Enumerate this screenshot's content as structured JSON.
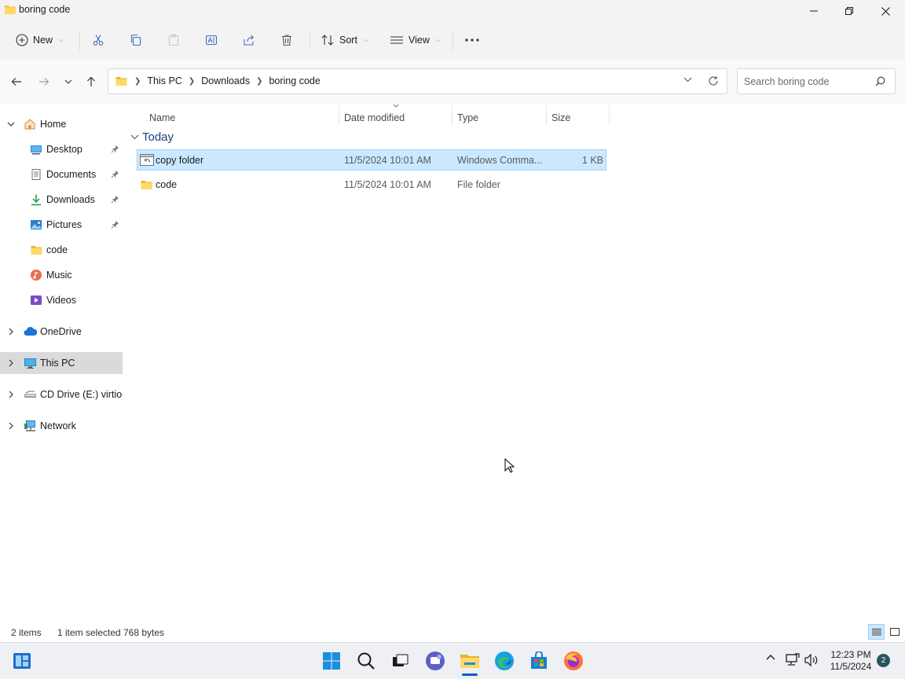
{
  "window": {
    "title": "boring code"
  },
  "toolbar": {
    "new_label": "New",
    "sort_label": "Sort",
    "view_label": "View"
  },
  "address": {
    "breadcrumbs": [
      "This PC",
      "Downloads",
      "boring code"
    ],
    "search_placeholder": "Search boring code"
  },
  "nav": {
    "items": [
      {
        "label": "Home",
        "icon": "home-icon"
      },
      {
        "label": "Desktop",
        "icon": "desktop-icon",
        "pinned": true
      },
      {
        "label": "Documents",
        "icon": "documents-icon",
        "pinned": true
      },
      {
        "label": "Downloads",
        "icon": "downloads-icon",
        "pinned": true
      },
      {
        "label": "Pictures",
        "icon": "pictures-icon",
        "pinned": true
      },
      {
        "label": "code",
        "icon": "folder-icon"
      },
      {
        "label": "Music",
        "icon": "music-icon"
      },
      {
        "label": "Videos",
        "icon": "videos-icon"
      },
      {
        "label": "OneDrive",
        "icon": "onedrive-icon"
      },
      {
        "label": "This PC",
        "icon": "this-pc-icon",
        "selected": true
      },
      {
        "label": "CD Drive (E:) virtio-win",
        "icon": "cd-drive-icon"
      },
      {
        "label": "Network",
        "icon": "network-icon"
      }
    ]
  },
  "list": {
    "columns": [
      "Name",
      "Date modified",
      "Type",
      "Size"
    ],
    "group": "Today",
    "rows": [
      {
        "name": "copy folder",
        "date": "11/5/2024 10:01 AM",
        "type": "Windows Comma...",
        "size": "1 KB",
        "icon": "batch-file-icon",
        "selected": true
      },
      {
        "name": "code",
        "date": "11/5/2024 10:01 AM",
        "type": "File folder",
        "size": "",
        "icon": "folder-icon"
      }
    ]
  },
  "status": {
    "item_count": "2 items",
    "selection": "1 item selected",
    "size": "768 bytes"
  },
  "taskbar": {
    "time": "12:23 PM",
    "date": "11/5/2024",
    "notification_count": "2"
  },
  "colors": {
    "selection_bg": "#cce8ff",
    "selection_border": "#99d1ff",
    "folder_yellow": "#f5c342",
    "accent": "#005fb8"
  }
}
